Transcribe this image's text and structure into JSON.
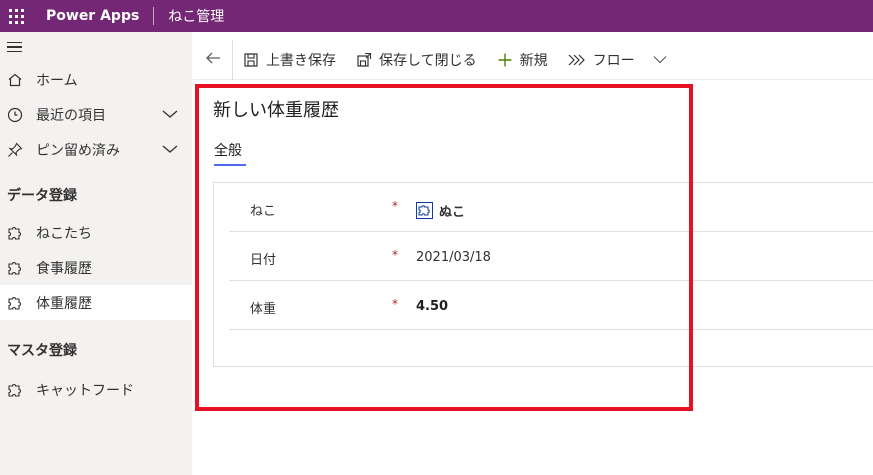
{
  "topbar": {
    "app_name": "Power Apps",
    "module": "ねこ管理"
  },
  "sidebar": {
    "items": [
      {
        "label": "ホーム",
        "icon": "home-icon"
      },
      {
        "label": "最近の項目",
        "icon": "clock-icon"
      },
      {
        "label": "ピン留め済み",
        "icon": "pin-icon"
      }
    ],
    "groups": [
      {
        "label": "データ登録",
        "items": [
          {
            "label": "ねこたち",
            "icon": "puzzle-icon"
          },
          {
            "label": "食事履歴",
            "icon": "puzzle-icon"
          },
          {
            "label": "体重履歴",
            "icon": "puzzle-icon",
            "active": true
          }
        ]
      },
      {
        "label": "マスタ登録",
        "items": [
          {
            "label": "キャットフード",
            "icon": "puzzle-icon"
          }
        ]
      }
    ]
  },
  "commands": {
    "save": "上書き保存",
    "save_close": "保存して閉じる",
    "new": "新規",
    "flow": "フロー"
  },
  "form": {
    "title": "新しい体重履歴",
    "tab": "全般",
    "fields": [
      {
        "label": "ねこ",
        "required": "*",
        "value": "ぬこ"
      },
      {
        "label": "日付",
        "required": "*",
        "value": "2021/03/18"
      },
      {
        "label": "体重",
        "required": "*",
        "value": "4.50"
      }
    ]
  },
  "colors": {
    "topbar": "#742774",
    "accent": "#4f6bed",
    "highlight": "#e81123"
  }
}
